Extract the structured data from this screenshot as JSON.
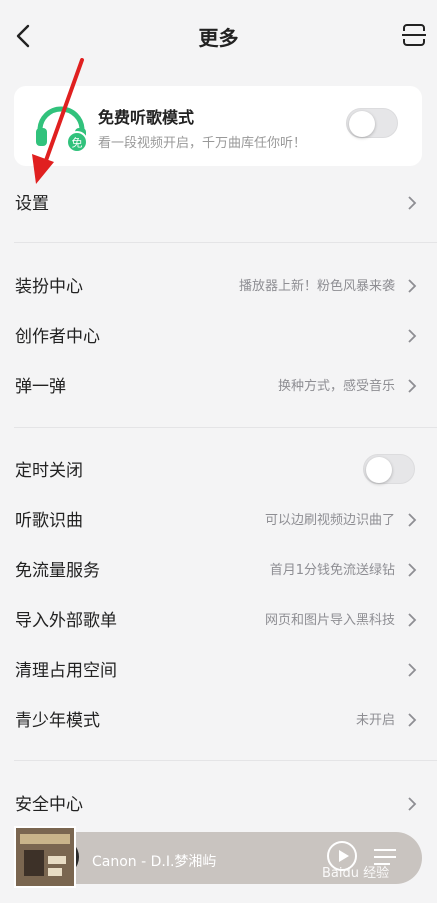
{
  "header": {
    "title": "更多"
  },
  "free_mode": {
    "title": "免费听歌模式",
    "subtitle": "看一段视频开启，千万曲库任你听！",
    "badge": "免",
    "enabled": false
  },
  "rows": [
    {
      "label": "设置",
      "hint": ""
    },
    {
      "label": "装扮中心",
      "hint": "播放器上新！粉色风暴来袭"
    },
    {
      "label": "创作者中心",
      "hint": ""
    },
    {
      "label": "弹一弹",
      "hint": "换种方式，感受音乐"
    },
    {
      "label": "定时关闭",
      "hint": "",
      "toggle": false
    },
    {
      "label": "听歌识曲",
      "hint": "可以边刷视频边识曲了"
    },
    {
      "label": "免流量服务",
      "hint": "首月1分钱免流送绿钻"
    },
    {
      "label": "导入外部歌单",
      "hint": "网页和图片导入黑科技"
    },
    {
      "label": "清理占用空间",
      "hint": ""
    },
    {
      "label": "青少年模式",
      "hint": "未开启"
    },
    {
      "label": "安全中心",
      "hint": ""
    }
  ],
  "player": {
    "track": "Canon - D.I.梦湘屿"
  },
  "watermark": "Baidu 经验",
  "colors": {
    "accent": "#31c27c",
    "arrow": "#e02020"
  }
}
